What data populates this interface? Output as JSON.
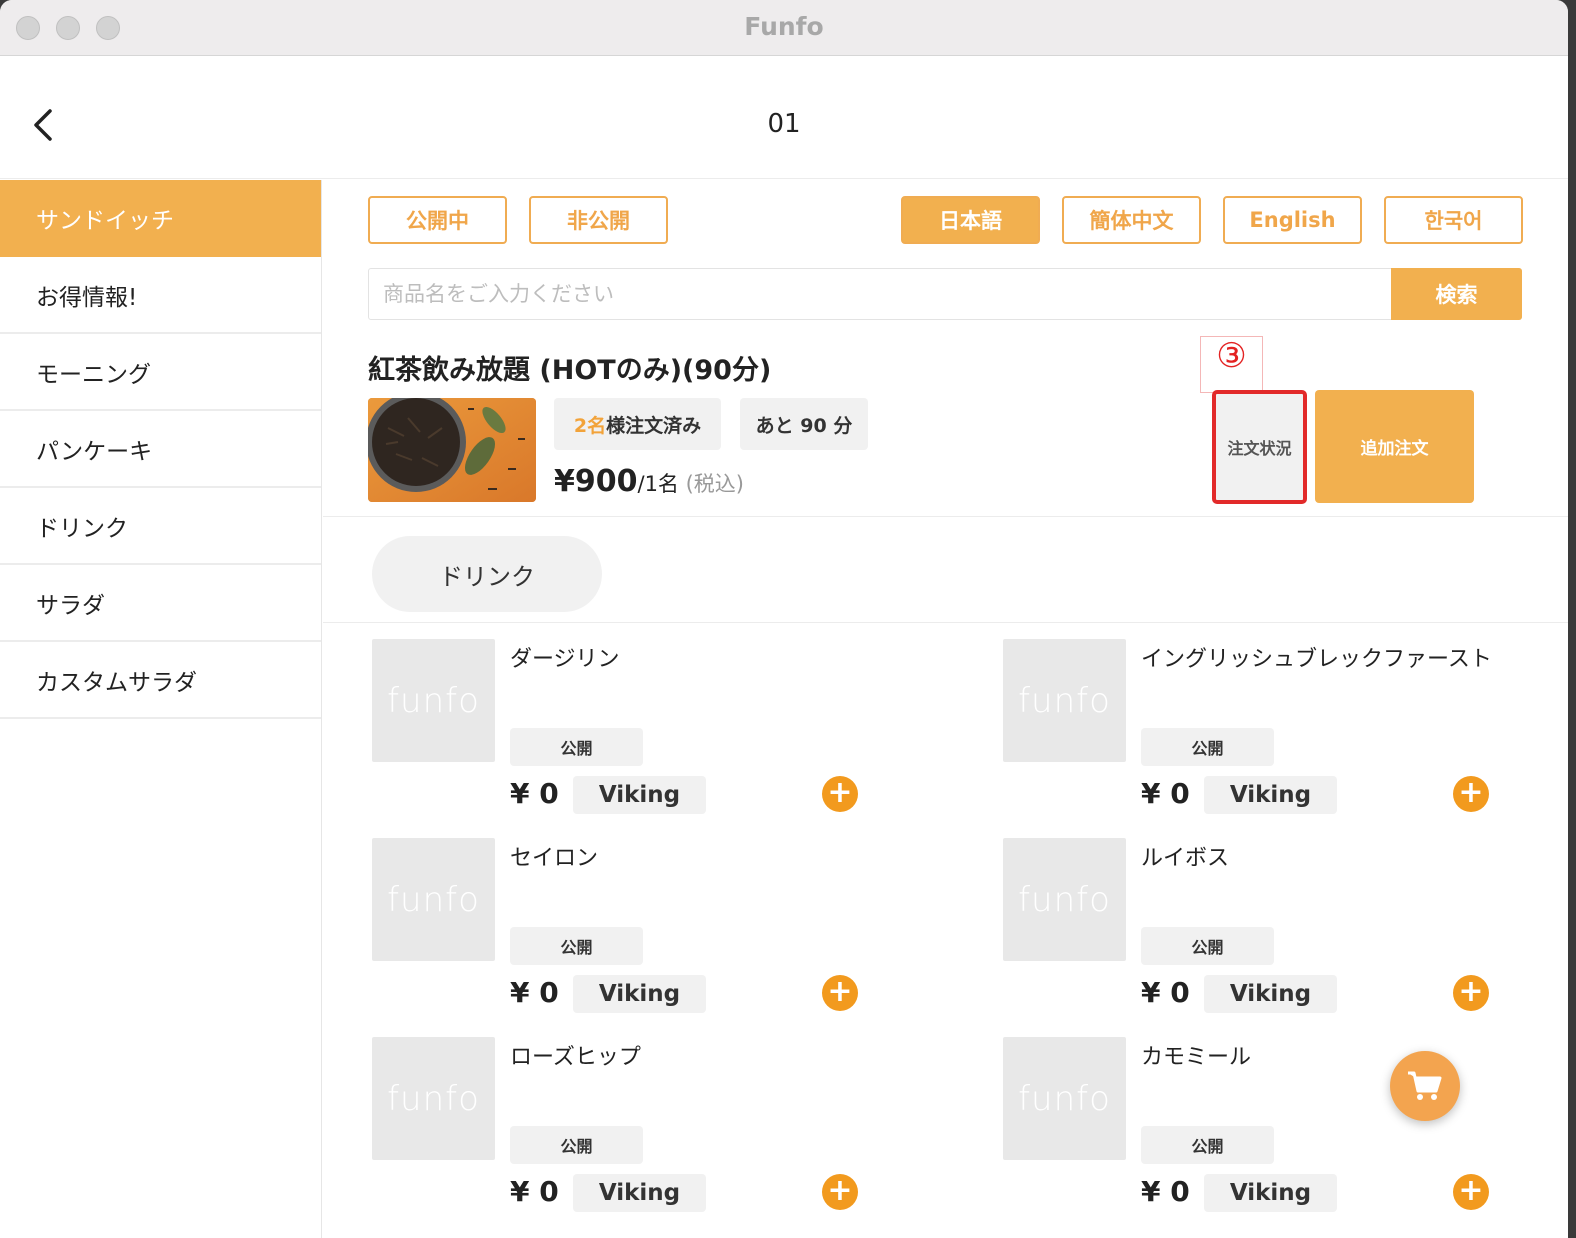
{
  "window": {
    "title": "Funfo"
  },
  "header": {
    "title": "01"
  },
  "sidebar": {
    "items": [
      {
        "label": "サンドイッチ"
      },
      {
        "label": "お得情報!"
      },
      {
        "label": "モーニング"
      },
      {
        "label": "パンケーキ"
      },
      {
        "label": "ドリンク"
      },
      {
        "label": "サラダ"
      },
      {
        "label": "カスタムサラダ"
      }
    ]
  },
  "filters": {
    "public": "公開中",
    "private": "非公開"
  },
  "languages": {
    "ja": "日本語",
    "zh": "簡体中文",
    "en": "English",
    "ko": "한국어"
  },
  "search": {
    "placeholder": "商品名をご入力ください",
    "button": "検索"
  },
  "plan": {
    "title": "紅茶飲み放題 (HOTのみ)(90分)",
    "ordered_count": "2名",
    "ordered_suffix": "様注文済み",
    "time_left": "あと 90 分",
    "price": "¥900",
    "price_unit": "/1名",
    "price_tax": " (税込)"
  },
  "annotation": {
    "label": "③"
  },
  "actions": {
    "order_status": "注文状況",
    "add_order": "追加注文"
  },
  "category": {
    "label": "ドリンク"
  },
  "products": [
    {
      "name": "ダージリン",
      "status": "公開",
      "price": "¥ 0",
      "tag": "Viking",
      "thumb": "funfo"
    },
    {
      "name": "イングリッシュブレックファースト",
      "status": "公開",
      "price": "¥ 0",
      "tag": "Viking",
      "thumb": "funfo"
    },
    {
      "name": "セイロン",
      "status": "公開",
      "price": "¥ 0",
      "tag": "Viking",
      "thumb": "funfo"
    },
    {
      "name": "ルイボス",
      "status": "公開",
      "price": "¥ 0",
      "tag": "Viking",
      "thumb": "funfo"
    },
    {
      "name": "ローズヒップ",
      "status": "公開",
      "price": "¥ 0",
      "tag": "Viking",
      "thumb": "funfo"
    },
    {
      "name": "カモミール",
      "status": "公開",
      "price": "¥ 0",
      "tag": "Viking",
      "thumb": "funfo"
    }
  ],
  "icons": {
    "back": "chevron-left-icon",
    "add": "plus-icon",
    "cart": "cart-icon"
  },
  "colors": {
    "accent": "#f2b04f",
    "add_button": "#f29a1e",
    "highlight_border": "#e22a2a"
  }
}
